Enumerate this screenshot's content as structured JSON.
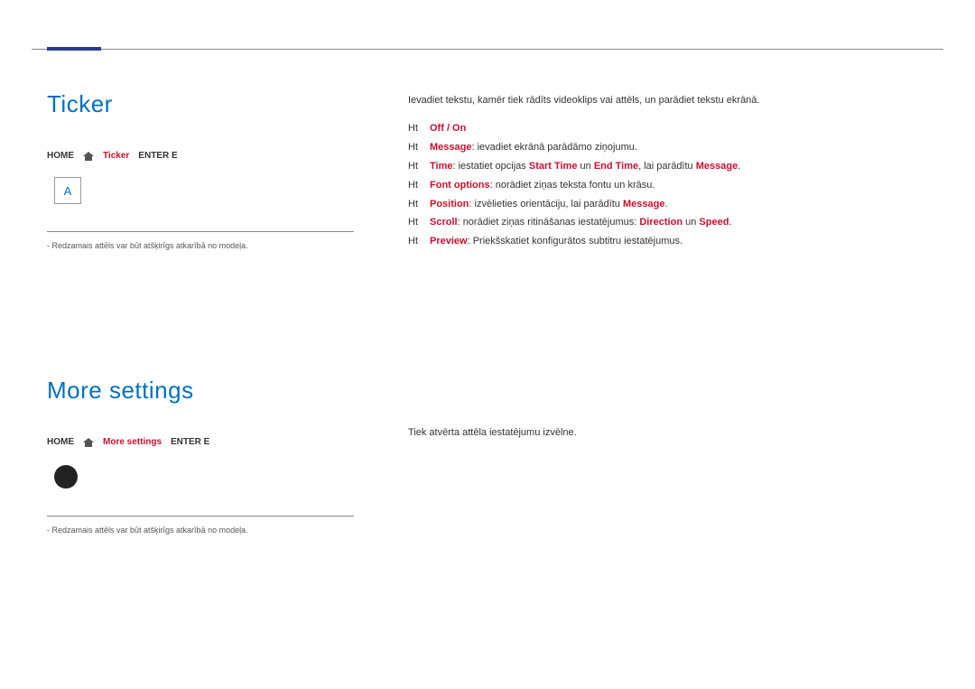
{
  "section1": {
    "title": "Ticker",
    "breadcrumb": {
      "home": "HOME",
      "item": "Ticker",
      "enter": "ENTER E"
    },
    "preview_letter": "A",
    "note": "- Redzamais attēls var būt atšķirīgs atkarībā no modeļa.",
    "intro": "Ievadiet tekstu, kamēr tiek rādīts videoklips vai attēls, un parādiet tekstu ekrānā.",
    "items": [
      {
        "label": "Off / On",
        "text": ""
      },
      {
        "label": "Message",
        "text": ": ievadiet ekrānā parādāmo ziņojumu."
      },
      {
        "label": "Time",
        "text": ": iestatiet opcijas ",
        "mid1": "Start Time",
        "conn1": " un ",
        "mid2": "End Time",
        "conn2": ", lai parādītu ",
        "mid3": "Message",
        "end": "."
      },
      {
        "label": "Font options",
        "text": ": norādiet ziņas teksta fontu un krāsu."
      },
      {
        "label": "Position",
        "text": ": izvēlieties orientāciju, lai parādītu ",
        "mid1": "Message",
        "end": "."
      },
      {
        "label": "Scroll",
        "text": ": norādiet ziņas ritināšanas iestatējumus: ",
        "mid1": "Direction",
        "conn1": " un ",
        "mid2": "Speed",
        "end": "."
      },
      {
        "label": "Preview",
        "text": ": Priekšskatiet konfigurātos subtitru iestatējumus."
      }
    ]
  },
  "section2": {
    "title": "More settings",
    "breadcrumb": {
      "home": "HOME",
      "item": "More settings",
      "enter": "ENTER E"
    },
    "note": "- Redzamais attēls var būt atšķirīgs atkarībā no modeļa.",
    "intro": "Tiek atvērta attēla iestatējumu izvēlne."
  }
}
